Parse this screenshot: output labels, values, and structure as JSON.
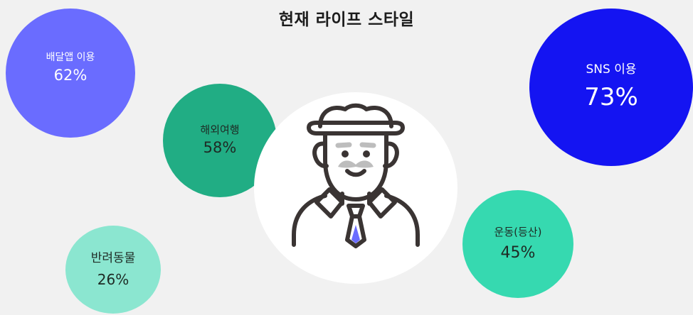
{
  "title": "현재 라이프 스타일",
  "avatar": {
    "icon": "elderly-man-with-hat-icon"
  },
  "bubbles": [
    {
      "label": "배달앱 이용",
      "value": "62%",
      "color": "#6a6cff",
      "text_color": "#ffffff"
    },
    {
      "label": "SNS 이용",
      "value": "73%",
      "color": "#1414f2",
      "text_color": "#ffffff"
    },
    {
      "label": "해외여행",
      "value": "58%",
      "color": "#21ad84",
      "text_color": "#1e2a24"
    },
    {
      "label": "반려동물",
      "value": "26%",
      "color": "#8be6d0",
      "text_color": "#1e2a24"
    },
    {
      "label": "운동(등산)",
      "value": "45%",
      "color": "#36d9b0",
      "text_color": "#1e2a24"
    }
  ],
  "colors": {
    "background": "#f1f1f1",
    "avatar_circle": "#ffffff",
    "line": "#3a3433",
    "accent_tie": "#6a6cff"
  }
}
